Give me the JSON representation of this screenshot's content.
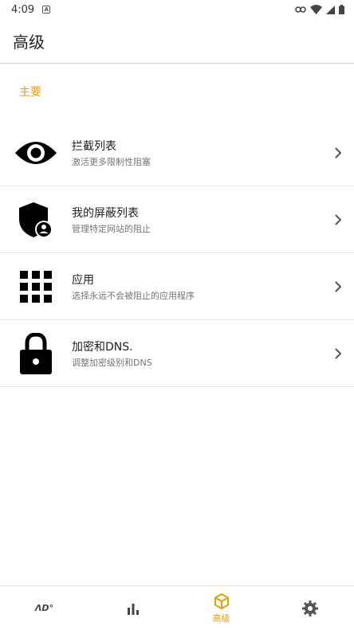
{
  "status_bar": {
    "time": "4:09",
    "badge": "A"
  },
  "app_bar": {
    "title": "高级"
  },
  "section": {
    "label": "主要"
  },
  "items": [
    {
      "title": "拦截列表",
      "subtitle": "激活更多限制性阻塞",
      "icon": "eye-icon"
    },
    {
      "title": "我的屏蔽列表",
      "subtitle": "管理特定网站的阻止",
      "icon": "shield-user-icon"
    },
    {
      "title": "应用",
      "subtitle": "选择永远不会被阻止的应用程序",
      "icon": "apps-grid-icon"
    },
    {
      "title": "加密和DNS.",
      "subtitle": "调整加密级别和DNS",
      "icon": "lock-icon"
    }
  ],
  "bottom_nav": {
    "items": [
      {
        "icon": "ads-icon",
        "glyph": "ΛD°"
      },
      {
        "icon": "stats-icon"
      },
      {
        "icon": "package-icon",
        "label": "高级",
        "active": true
      },
      {
        "icon": "gear-icon"
      }
    ]
  },
  "colors": {
    "accent": "#e0a000",
    "text": "#212121",
    "muted": "#757575"
  }
}
